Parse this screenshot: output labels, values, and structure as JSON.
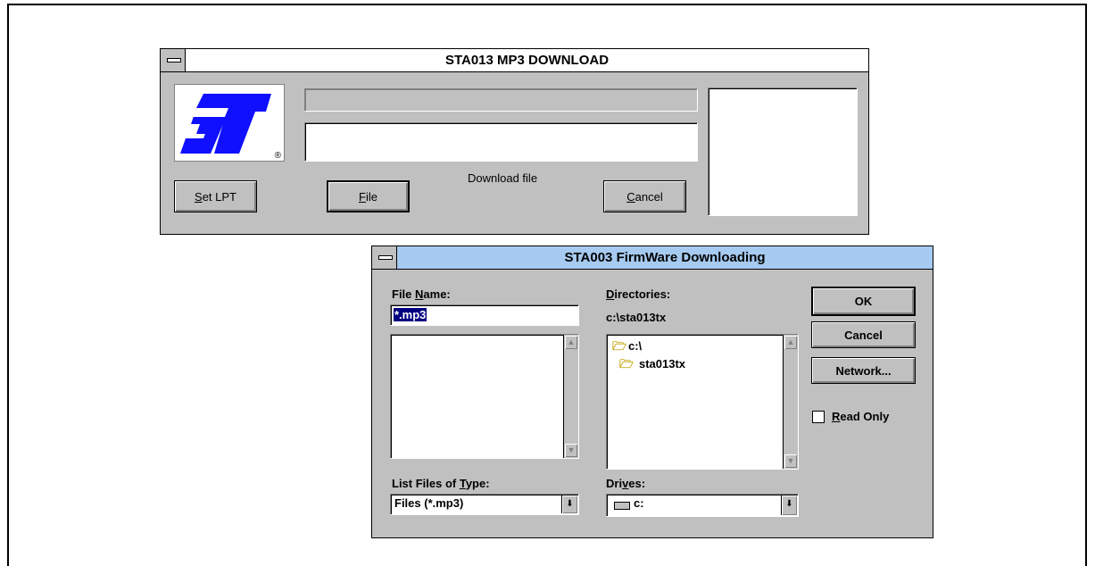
{
  "main_window": {
    "title": "STA013 MP3 DOWNLOAD",
    "logo_registered": "®",
    "status_label": "Download file",
    "buttons": {
      "set_lpt": {
        "mnemonic": "S",
        "rest": "et LPT"
      },
      "file": {
        "mnemonic": "F",
        "rest": "ile"
      },
      "cancel": {
        "mnemonic": "C",
        "rest": "ancel"
      }
    }
  },
  "dialog": {
    "title": "STA003 FirmWare Downloading",
    "file_name_label": {
      "pre": "File ",
      "mnemonic": "N",
      "post": "ame:"
    },
    "file_name_value": "*.mp3",
    "directories_label": {
      "mnemonic": "D",
      "post": "irectories:"
    },
    "current_directory": "c:\\sta013tx",
    "directory_tree": [
      {
        "name": "c:\\",
        "icon": "open-folder-icon"
      },
      {
        "name": "sta013tx",
        "icon": "open-folder-icon"
      }
    ],
    "file_type_label": {
      "pre": "List Files of ",
      "mnemonic": "T",
      "post": "ype:"
    },
    "file_type_value": "Files (*.mp3)",
    "drives_label": {
      "pre": "Dri",
      "mnemonic": "v",
      "post": "es:"
    },
    "drive_value": "c:",
    "buttons": {
      "ok": "OK",
      "cancel": "Cancel",
      "network": "Network..."
    },
    "read_only_label": {
      "mnemonic": "R",
      "post": "ead Only"
    },
    "read_only_checked": false
  },
  "colors": {
    "window_face": "#c0c0c0",
    "active_title": "#a6caf0",
    "logo_blue": "#1010ff",
    "selection": "#000080"
  }
}
